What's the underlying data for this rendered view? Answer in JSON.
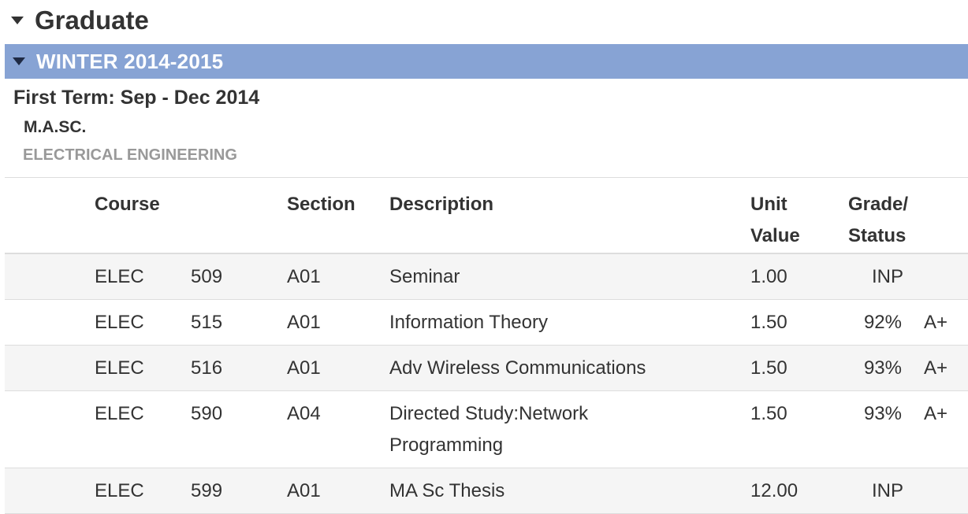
{
  "section": {
    "title": "Graduate"
  },
  "term": {
    "bar_title": "WINTER 2014-2015",
    "label": "First Term: Sep - Dec 2014",
    "degree": "M.A.SC.",
    "program": "ELECTRICAL ENGINEERING"
  },
  "table": {
    "headers": {
      "course": "Course",
      "section": "Section",
      "description": "Description",
      "unit_line1": "Unit",
      "unit_line2": "Value",
      "grade_line1": "Grade/",
      "grade_line2": "Status"
    },
    "rows": [
      {
        "subject": "ELEC",
        "number": "509",
        "section": "A01",
        "description": "Seminar",
        "unit": "1.00",
        "status": "INP",
        "percent": "",
        "letter": ""
      },
      {
        "subject": "ELEC",
        "number": "515",
        "section": "A01",
        "description": "Information Theory",
        "unit": "1.50",
        "status": "",
        "percent": "92%",
        "letter": "A+"
      },
      {
        "subject": "ELEC",
        "number": "516",
        "section": "A01",
        "description": "Adv Wireless Communications",
        "unit": "1.50",
        "status": "",
        "percent": "93%",
        "letter": "A+"
      },
      {
        "subject": "ELEC",
        "number": "590",
        "section": "A04",
        "description": "Directed Study:Network Programming",
        "unit": "1.50",
        "status": "",
        "percent": "93%",
        "letter": "A+"
      },
      {
        "subject": "ELEC",
        "number": "599",
        "section": "A01",
        "description": "MA Sc Thesis",
        "unit": "12.00",
        "status": "INP",
        "percent": "",
        "letter": ""
      }
    ]
  },
  "colors": {
    "term_bar": "#87a3d4",
    "row_alt": "#f5f5f5",
    "muted_text": "#999999"
  }
}
